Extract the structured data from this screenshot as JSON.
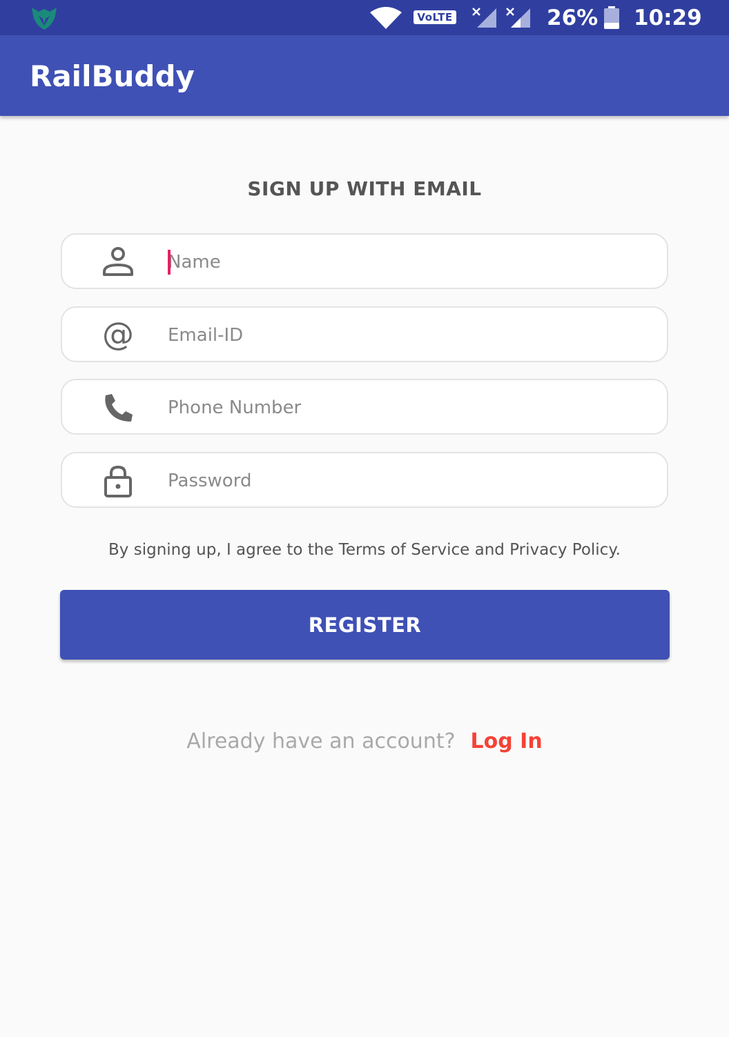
{
  "status_bar": {
    "app_icon": "fox-shield-icon",
    "wifi_icon": "wifi-icon",
    "volte_label": "VoLTE",
    "signal_icons": [
      "signal-no-data-icon",
      "signal-no-data-icon"
    ],
    "battery_percent": "26%",
    "battery_icon": "battery-icon",
    "time": "10:29"
  },
  "app_bar": {
    "title": "RailBuddy"
  },
  "form": {
    "heading": "SIGN UP WITH EMAIL",
    "fields": [
      {
        "icon": "person-icon",
        "placeholder": "Name",
        "value": ""
      },
      {
        "icon": "at-sign-icon",
        "placeholder": "Email-ID",
        "value": ""
      },
      {
        "icon": "phone-icon",
        "placeholder": "Phone Number",
        "value": ""
      },
      {
        "icon": "lock-icon",
        "placeholder": "Password",
        "value": ""
      }
    ],
    "terms_text": "By signing up, I agree to the Terms of Service and Privacy Policy.",
    "register_label": "REGISTER"
  },
  "footer": {
    "question": "Already have an account?",
    "login_label": "Log In"
  },
  "colors": {
    "status_bar": "#303f9f",
    "primary": "#3f51b5",
    "accent": "#f44336",
    "caret": "#e91e63",
    "background": "#fafafa"
  }
}
